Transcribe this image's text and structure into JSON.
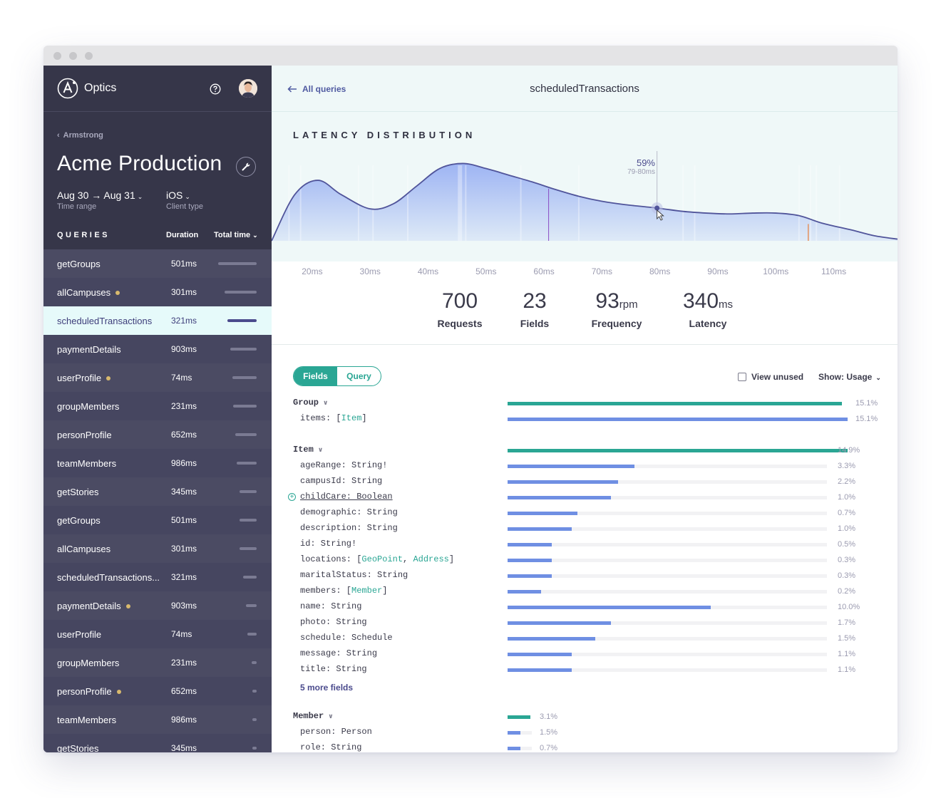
{
  "app": {
    "brand": "Optics"
  },
  "sidebar": {
    "breadcrumb": "Armstrong",
    "project": "Acme Production",
    "filters": [
      {
        "value": "Aug 30 → Aug 31",
        "label": "Time range"
      },
      {
        "value": "iOS",
        "label": "Client type"
      }
    ],
    "queries_header": {
      "title": "QUERIES",
      "col_duration": "Duration",
      "col_total": "Total time"
    },
    "queries": [
      {
        "name": "getGroups",
        "duration": "501ms",
        "dot": false,
        "total": 0.9,
        "active": false
      },
      {
        "name": "allCampuses",
        "duration": "301ms",
        "dot": true,
        "total": 0.75,
        "active": false
      },
      {
        "name": "scheduledTransactions",
        "duration": "321ms",
        "dot": false,
        "total": 0.68,
        "active": true
      },
      {
        "name": "paymentDetails",
        "duration": "903ms",
        "dot": false,
        "total": 0.62,
        "active": false
      },
      {
        "name": "userProfile",
        "duration": "74ms",
        "dot": true,
        "total": 0.56,
        "active": false
      },
      {
        "name": "groupMembers",
        "duration": "231ms",
        "dot": false,
        "total": 0.55,
        "active": false
      },
      {
        "name": "personProfile",
        "duration": "652ms",
        "dot": false,
        "total": 0.5,
        "active": false
      },
      {
        "name": "teamMembers",
        "duration": "986ms",
        "dot": false,
        "total": 0.47,
        "active": false
      },
      {
        "name": "getStories",
        "duration": "345ms",
        "dot": false,
        "total": 0.4,
        "active": false
      },
      {
        "name": "getGroups",
        "duration": "501ms",
        "dot": false,
        "total": 0.4,
        "active": false
      },
      {
        "name": "allCampuses",
        "duration": "301ms",
        "dot": false,
        "total": 0.4,
        "active": false
      },
      {
        "name": "scheduledTransactions...",
        "duration": "321ms",
        "dot": false,
        "total": 0.32,
        "active": false
      },
      {
        "name": "paymentDetails",
        "duration": "903ms",
        "dot": true,
        "total": 0.25,
        "active": false
      },
      {
        "name": "userProfile",
        "duration": "74ms",
        "dot": false,
        "total": 0.22,
        "active": false
      },
      {
        "name": "groupMembers",
        "duration": "231ms",
        "dot": false,
        "total": 0.12,
        "active": false
      },
      {
        "name": "personProfile",
        "duration": "652ms",
        "dot": true,
        "total": 0.1,
        "active": false
      },
      {
        "name": "teamMembers",
        "duration": "986ms",
        "dot": false,
        "total": 0.0,
        "active": false
      },
      {
        "name": "getStories",
        "duration": "345ms",
        "dot": false,
        "total": 0.0,
        "active": false
      }
    ]
  },
  "main": {
    "back_label": "All queries",
    "title": "scheduledTransactions",
    "section_title": "LATENCY DISTRIBUTION",
    "tooltip": {
      "pct": "59%",
      "range": "79-80ms"
    },
    "stats": [
      {
        "value": "700",
        "unit": "",
        "label": "Requests"
      },
      {
        "value": "23",
        "unit": "",
        "label": "Fields"
      },
      {
        "value": "93",
        "unit": "rpm",
        "label": "Frequency"
      },
      {
        "value": "340",
        "unit": "ms",
        "label": "Latency"
      }
    ],
    "tabs": {
      "fields": "Fields",
      "query": "Query"
    },
    "view_unused": "View unused",
    "show": "Show: Usage",
    "more_fields": "5 more fields"
  },
  "chart_data": {
    "type": "area",
    "title": "LATENCY DISTRIBUTION",
    "xlabel": "",
    "ylabel": "",
    "x_ticks": [
      "20ms",
      "30ms",
      "40ms",
      "50ms",
      "60ms",
      "70ms",
      "80ms",
      "90ms",
      "100ms",
      "110ms"
    ],
    "xlim": [
      13,
      121
    ],
    "ylim": [
      0,
      1
    ],
    "x": [
      13,
      17,
      21,
      25,
      30,
      34,
      38,
      42,
      46,
      50,
      54,
      58,
      62,
      66,
      70,
      74,
      79.5,
      84,
      88,
      92,
      96,
      100,
      104,
      108,
      113,
      117,
      121
    ],
    "y": [
      0,
      0.55,
      0.72,
      0.55,
      0.38,
      0.44,
      0.65,
      0.86,
      0.92,
      0.86,
      0.78,
      0.7,
      0.61,
      0.53,
      0.47,
      0.43,
      0.39,
      0.35,
      0.33,
      0.32,
      0.33,
      0.33,
      0.3,
      0.21,
      0.13,
      0.06,
      0.02
    ],
    "highlight": {
      "x": 79.5,
      "y": 0.39,
      "label": "59%",
      "range": "79-80ms"
    },
    "colors": {
      "line": "#50549a",
      "fill": "#8fa8f2",
      "accent": "#2aa694",
      "marker_purple": "#8a4bc4",
      "marker_orange": "#e4915f"
    }
  },
  "field_groups": [
    {
      "name": "Group",
      "pct": "15.1%",
      "frac": 0.983,
      "fields": [
        {
          "parts": [
            "items: [",
            "Item",
            "]"
          ],
          "pct": "15.1%",
          "frac": 0.985
        }
      ]
    },
    {
      "name": "Item",
      "pct": "14.9%",
      "frac": 1.0,
      "fields": [
        {
          "parts": [
            "ageRange: String!"
          ],
          "pct": "3.3%",
          "frac": 0.398
        },
        {
          "parts": [
            "campusId: String"
          ],
          "pct": "2.2%",
          "frac": 0.347
        },
        {
          "parts": [
            "childCare: Boolean"
          ],
          "pct": "1.0%",
          "frac": 0.324,
          "add": true
        },
        {
          "parts": [
            "demographic: String"
          ],
          "pct": "0.7%",
          "frac": 0.218
        },
        {
          "parts": [
            "description: String"
          ],
          "pct": "1.0%",
          "frac": 0.202
        },
        {
          "parts": [
            "id: String!"
          ],
          "pct": "0.5%",
          "frac": 0.138
        },
        {
          "parts": [
            "locations: [",
            "GeoPoint",
            ", ",
            "Address",
            "]"
          ],
          "pct": "0.3%",
          "frac": 0.138
        },
        {
          "parts": [
            "maritalStatus: String"
          ],
          "pct": "0.3%",
          "frac": 0.138
        },
        {
          "parts": [
            "members: [",
            "Member",
            "]"
          ],
          "pct": "0.2%",
          "frac": 0.105
        },
        {
          "parts": [
            "name: String"
          ],
          "pct": "10.0%",
          "frac": 0.637
        },
        {
          "parts": [
            "photo: String"
          ],
          "pct": "1.7%",
          "frac": 0.324
        },
        {
          "parts": [
            "schedule: Schedule"
          ],
          "pct": "1.5%",
          "frac": 0.275
        },
        {
          "parts": [
            "message: String"
          ],
          "pct": "1.1%",
          "frac": 0.202
        },
        {
          "parts": [
            "title: String"
          ],
          "pct": "1.1%",
          "frac": 0.202
        }
      ]
    },
    {
      "name": "Member",
      "pct": "3.1%",
      "frac": 0.94,
      "fields": [
        {
          "parts": [
            "person: Person"
          ],
          "pct": "1.5%",
          "frac": 0.53
        },
        {
          "parts": [
            "role: String"
          ],
          "pct": "0.7%",
          "frac": 0.53
        }
      ]
    }
  ]
}
